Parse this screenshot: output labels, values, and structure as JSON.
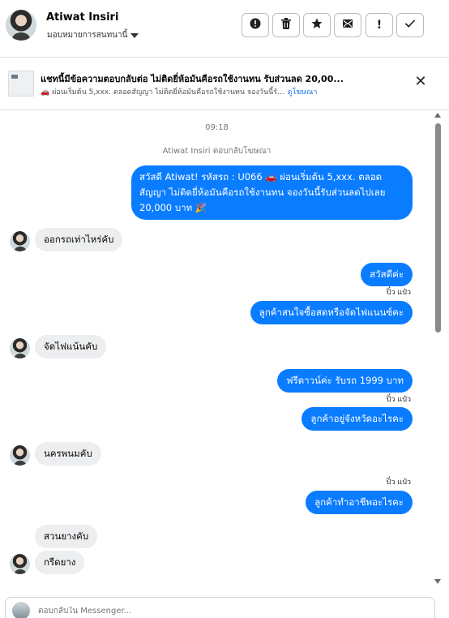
{
  "header": {
    "contact_name": "Atiwat Insiri",
    "assign_label": "มอบหมายการสนทนานี้",
    "toolbar": [
      {
        "icon": "!",
        "name": "spam-icon"
      },
      {
        "icon": "🗑",
        "name": "trash-icon"
      },
      {
        "icon": "★",
        "name": "star-icon"
      },
      {
        "icon": "✉",
        "name": "mark-unread-icon"
      },
      {
        "icon": "!",
        "name": "follow-up-icon"
      },
      {
        "icon": "✓",
        "name": "done-icon"
      }
    ]
  },
  "ad_banner": {
    "title": "แชทนี้มีข้อความตอบกลับต่อ ไม่ติดยี่ห้อมันคือรถใช้งานทน รับส่วนลด 20,00...",
    "subtitle": "🚗 ผ่อนเริ่มต้น 5,xxx. ตลอดสัญญา ไม่ติดยี่ห้อมันคือรถใช้งานทน จองวันนี้รั...",
    "link": "ดูโฆษณา"
  },
  "thread": {
    "timestamp": "09:18",
    "ad_reply_note": "Atiwat Insiri ตอบกลับโฆษณา",
    "msg_ad": "สวัสดี Atiwat! รหัสรถ : U066 🚗 ผ่อนเริ่มต้น 5,xxx. ตลอดสัญญา ไม่ติดยี่ห้อมันคือรถใช้งานทน จองวันนี้รับส่วนลดไปเลย 20,000 บาท 🎉",
    "msg_in_1": "ออกรถเท่าไหร่คับ",
    "msg_out_1": "สวัสดีค่ะ",
    "seen_1": "ปิ๋ว แป๋ว",
    "msg_out_2": "ลูกค้าสนใจซื้อสดหรือจัดไฟแนนซ์คะ",
    "msg_in_2": "จัดไฟแน้นคับ",
    "msg_out_3": "ฟรีดาวน์ค่ะ  รับรถ 1999 บาท",
    "seen_2": "ปิ๋ว แป๋ว",
    "msg_out_4": "ลูกค้าอยู่จังหวัดอะไรคะ",
    "msg_in_3": "นครพนมคับ",
    "seen_3": "ปิ๋ว แป๋ว",
    "msg_out_5": "ลูกค้าทำอาชีพอะไรคะ",
    "msg_in_4": "สวนยางคับ",
    "msg_in_5": "กรีดยาง"
  },
  "composer": {
    "placeholder": "ตอบกลับใน Messenger..."
  }
}
